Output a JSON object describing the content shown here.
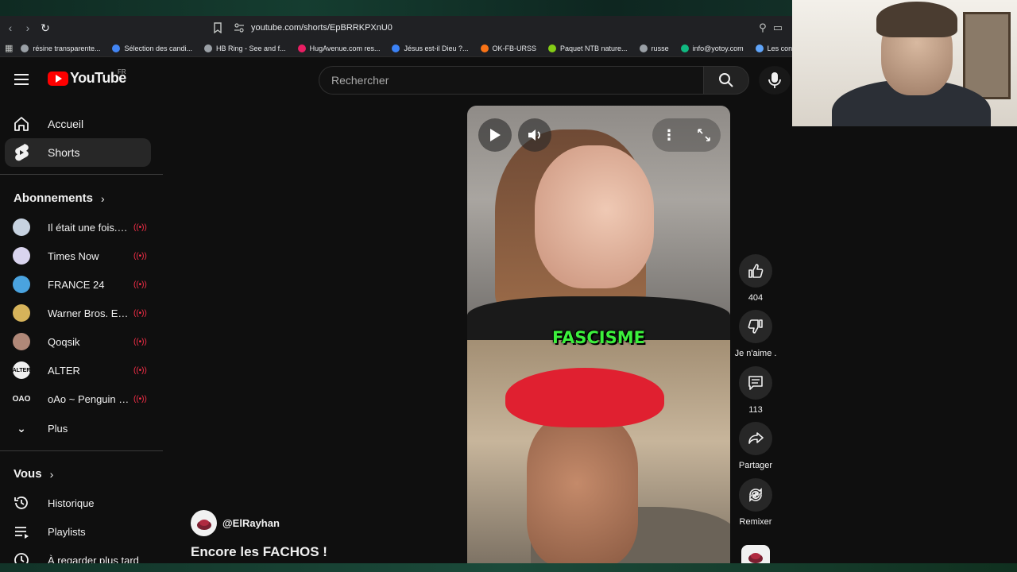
{
  "browser": {
    "url": "youtube.com/shorts/EpBRRKPXnU0",
    "bookmarks": [
      {
        "label": "résine transparente...",
        "color": "#9aa0a6"
      },
      {
        "label": "Sélection des candi...",
        "color": "#4285f4"
      },
      {
        "label": "HB Ring - See and f...",
        "color": "#9aa0a6"
      },
      {
        "label": "HugAvenue.com res...",
        "color": "#e91e63"
      },
      {
        "label": "Jésus est-il Dieu ?...",
        "color": "#3b82f6"
      },
      {
        "label": "OK-FB-URSS",
        "color": "#f97316"
      },
      {
        "label": "Paquet NTB nature...",
        "color": "#84cc16"
      },
      {
        "label": "russe",
        "color": "#9aa0a6"
      },
      {
        "label": "info@yotoy.com",
        "color": "#10b981"
      },
      {
        "label": "Les concours d'...",
        "color": "#60a5fa"
      }
    ]
  },
  "header": {
    "logo_text": "YouTube",
    "country": "FR",
    "search_placeholder": "Rechercher"
  },
  "sidebar": {
    "main": [
      {
        "label": "Accueil",
        "icon": "home-icon",
        "active": false
      },
      {
        "label": "Shorts",
        "icon": "shorts-icon",
        "active": true
      }
    ],
    "subscriptions_heading": "Abonnements",
    "subscriptions": [
      {
        "label": "Il était une fois... ...",
        "color": "#c7d2e0"
      },
      {
        "label": "Times Now",
        "color": "#d9d4ee"
      },
      {
        "label": "FRANCE 24",
        "color": "#4aa3df"
      },
      {
        "label": "Warner Bros. Ent...",
        "color": "#d6b35a"
      },
      {
        "label": "Qoqsik",
        "color": "#b08878"
      },
      {
        "label": "ALTER",
        "avatar_text": "ALTER",
        "color": "#f1f1f1"
      },
      {
        "label": "oAo ~ Penguin J...",
        "avatar_text": "OAO",
        "color": "#0f0f0f"
      }
    ],
    "more_label": "Plus",
    "you_heading": "Vous",
    "you": [
      {
        "label": "Historique",
        "icon": "history-icon"
      },
      {
        "label": "Playlists",
        "icon": "playlist-icon"
      },
      {
        "label": "À regarder plus tard",
        "icon": "watch-later-icon"
      }
    ]
  },
  "video": {
    "caption": "FASCISME",
    "channel_handle": "@ElRayhan",
    "title": "Encore les FACHOS !"
  },
  "actions": {
    "like_count": "404",
    "dislike_label": "Je n'aime .",
    "comment_count": "113",
    "share_label": "Partager",
    "remix_label": "Remixer"
  }
}
